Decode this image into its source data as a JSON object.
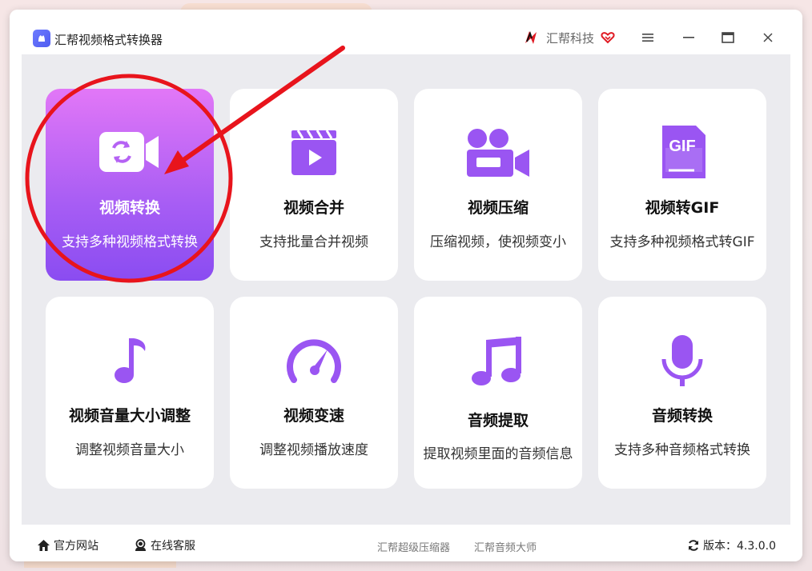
{
  "window": {
    "title": "汇帮视频格式转换器",
    "brand": "汇帮科技"
  },
  "cards": [
    {
      "title": "视频转换",
      "desc": "支持多种视频格式转换",
      "icon": "video-convert-icon",
      "active": true
    },
    {
      "title": "视频合并",
      "desc": "支持批量合并视频",
      "icon": "video-merge-icon"
    },
    {
      "title": "视频压缩",
      "desc": "压缩视频，使视频变小",
      "icon": "video-camera-icon"
    },
    {
      "title": "视频转GIF",
      "desc": "支持多种视频格式转GIF",
      "icon": "gif-icon"
    },
    {
      "title": "视频音量大小调整",
      "desc": "调整视频音量大小",
      "icon": "music-note-icon"
    },
    {
      "title": "视频变速",
      "desc": "调整视频播放速度",
      "icon": "speedometer-icon"
    },
    {
      "title": "音频提取",
      "desc": "提取视频里面的音频信息",
      "icon": "music-notes-icon"
    },
    {
      "title": "音频转换",
      "desc": "支持多种音频格式转换",
      "icon": "microphone-icon"
    }
  ],
  "footer": {
    "website": "官方网站",
    "support": "在线客服",
    "link1": "汇帮超级压缩器",
    "link2": "汇帮音频大师",
    "version": "版本：4.3.0.0"
  },
  "colors": {
    "accent": "#9a55f2",
    "active_gradient_top": "#e277f7",
    "active_gradient_bottom": "#8a4cf1",
    "annotation_red": "#e8141c"
  }
}
